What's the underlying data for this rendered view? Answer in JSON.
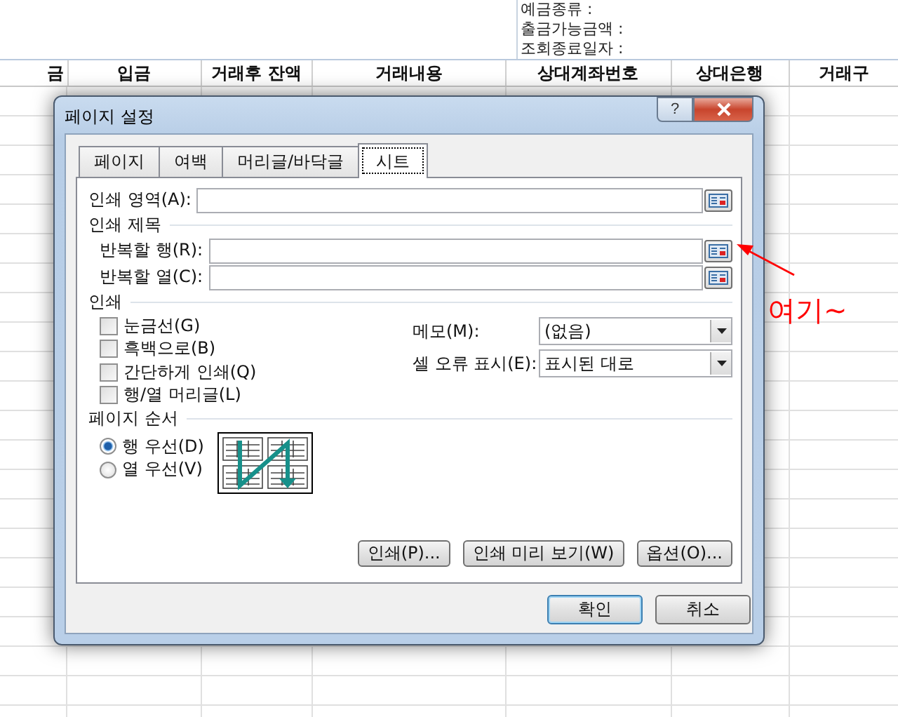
{
  "sheet": {
    "info_lines": [
      "예금종류 :",
      "출금가능금액 :",
      "조회종료일자 :"
    ],
    "columns": [
      "금",
      "입금",
      "거래후 잔액",
      "거래내용",
      "상대계좌번호",
      "상대은행",
      "거래구"
    ]
  },
  "dialog": {
    "title": "페이지 설정",
    "help": "?",
    "tabs": [
      {
        "label": "페이지",
        "selected": false
      },
      {
        "label": "여백",
        "selected": false
      },
      {
        "label": "머리글/바닥글",
        "selected": false
      },
      {
        "label": "시트",
        "selected": true
      }
    ],
    "print_area": {
      "label": "인쇄 영역(A):"
    },
    "print_titles": {
      "heading": "인쇄 제목",
      "rows": [
        {
          "label": "반복할 행(R):"
        },
        {
          "label": "반복할 열(C):"
        }
      ]
    },
    "print": {
      "heading": "인쇄",
      "options": [
        {
          "label": "눈금선(G)",
          "checked": false
        },
        {
          "label": "흑백으로(B)",
          "checked": false
        },
        {
          "label": "간단하게 인쇄(Q)",
          "checked": false
        },
        {
          "label": "행/열 머리글(L)",
          "checked": false
        }
      ],
      "dropdowns": [
        {
          "label": "메모(M):",
          "value": "(없음)"
        },
        {
          "label": "셀 오류 표시(E):",
          "value": "표시된 대로"
        }
      ]
    },
    "page_order": {
      "heading": "페이지 순서",
      "options": [
        {
          "label": "행 우선(D)",
          "selected": true
        },
        {
          "label": "열 우선(V)",
          "selected": false
        }
      ]
    },
    "action_buttons": [
      "인쇄(P)...",
      "인쇄 미리 보기(W)",
      "옵션(O)..."
    ],
    "footer_buttons": [
      {
        "label": "확인",
        "focused": true
      },
      {
        "label": "취소",
        "focused": false
      }
    ]
  },
  "annotation": {
    "text": "여기~"
  }
}
